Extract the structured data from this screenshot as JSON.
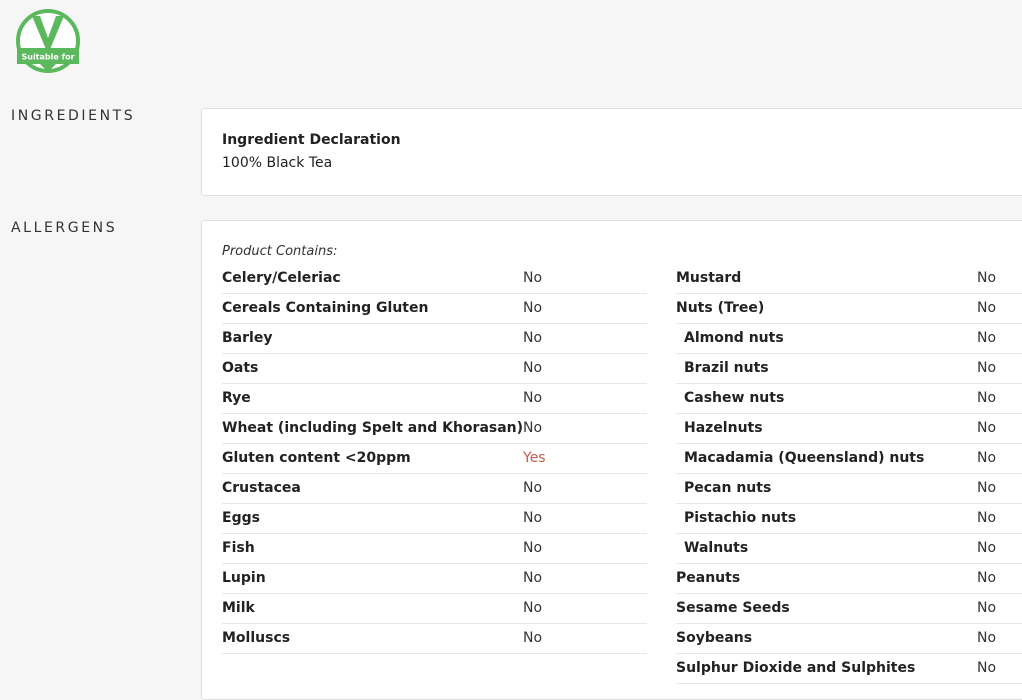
{
  "badge": {
    "icon": "vegan-v-icon",
    "text": "Suitable for",
    "color": "#5cb85c"
  },
  "ingredients": {
    "heading": "INGREDIENTS",
    "declaration_title": "Ingredient Declaration",
    "declaration_value": "100% Black Tea"
  },
  "allergens": {
    "heading": "ALLERGENS",
    "contains_label": "Product Contains:",
    "left": [
      {
        "name": "Celery/Celeriac",
        "value": "No",
        "sub": false
      },
      {
        "name": "Cereals Containing Gluten",
        "value": "No",
        "sub": false
      },
      {
        "name": "Barley",
        "value": "No",
        "sub": false
      },
      {
        "name": "Oats",
        "value": "No",
        "sub": false
      },
      {
        "name": "Rye",
        "value": "No",
        "sub": false
      },
      {
        "name": "Wheat (including Spelt and Khorasan)",
        "value": "No",
        "sub": false
      },
      {
        "name": "Gluten content <20ppm",
        "value": "Yes",
        "sub": false
      },
      {
        "name": "Crustacea",
        "value": "No",
        "sub": false
      },
      {
        "name": "Eggs",
        "value": "No",
        "sub": false
      },
      {
        "name": "Fish",
        "value": "No",
        "sub": false
      },
      {
        "name": "Lupin",
        "value": "No",
        "sub": false
      },
      {
        "name": "Milk",
        "value": "No",
        "sub": false
      },
      {
        "name": "Molluscs",
        "value": "No",
        "sub": false
      }
    ],
    "right": [
      {
        "name": "Mustard",
        "value": "No",
        "sub": false
      },
      {
        "name": "Nuts (Tree)",
        "value": "No",
        "sub": false
      },
      {
        "name": "Almond nuts",
        "value": "No",
        "sub": true
      },
      {
        "name": "Brazil nuts",
        "value": "No",
        "sub": true
      },
      {
        "name": "Cashew nuts",
        "value": "No",
        "sub": true
      },
      {
        "name": "Hazelnuts",
        "value": "No",
        "sub": true
      },
      {
        "name": "Macadamia (Queensland) nuts",
        "value": "No",
        "sub": true
      },
      {
        "name": "Pecan nuts",
        "value": "No",
        "sub": true
      },
      {
        "name": "Pistachio nuts",
        "value": "No",
        "sub": true
      },
      {
        "name": "Walnuts",
        "value": "No",
        "sub": true
      },
      {
        "name": "Peanuts",
        "value": "No",
        "sub": false
      },
      {
        "name": "Sesame Seeds",
        "value": "No",
        "sub": false
      },
      {
        "name": "Soybeans",
        "value": "No",
        "sub": false
      },
      {
        "name": "Sulphur Dioxide and Sulphites",
        "value": "No",
        "sub": false
      }
    ],
    "yes_color": "#c9594b"
  }
}
